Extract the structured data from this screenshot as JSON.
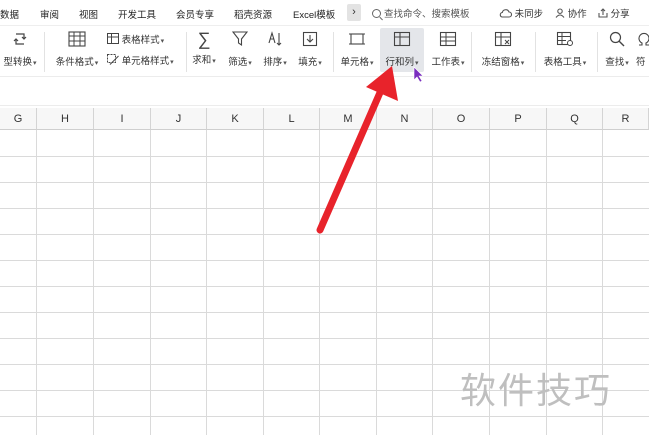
{
  "tabs": [
    {
      "label": "数据"
    },
    {
      "label": "审阅"
    },
    {
      "label": "视图"
    },
    {
      "label": "开发工具"
    },
    {
      "label": "会员专享"
    },
    {
      "label": "稻壳资源"
    },
    {
      "label": "Excel模板"
    }
  ],
  "more_glyph": "›",
  "search": {
    "placeholder": "查找命令、搜索模板"
  },
  "right": {
    "sync": "未同步",
    "collab": "协作",
    "share": "分享"
  },
  "ribbon": {
    "type_convert": "型转换",
    "cond_format": "条件格式",
    "table_style": "表格样式",
    "cell_style": "单元格样式",
    "sum": "求和",
    "filter": "筛选",
    "sort": "排序",
    "fill": "填充",
    "cell": "单元格",
    "row_col": "行和列",
    "worksheet": "工作表",
    "freeze": "冻结窗格",
    "table_tools": "表格工具",
    "find": "查找",
    "symbol": "符"
  },
  "columns": [
    "G",
    "H",
    "I",
    "J",
    "K",
    "L",
    "M",
    "N",
    "O",
    "P",
    "Q",
    "R"
  ],
  "watermark": "软件技巧",
  "colors": {
    "arrow": "#e8232b",
    "highlight": "#e4e6ea",
    "cursor": "#7a2dbf"
  }
}
